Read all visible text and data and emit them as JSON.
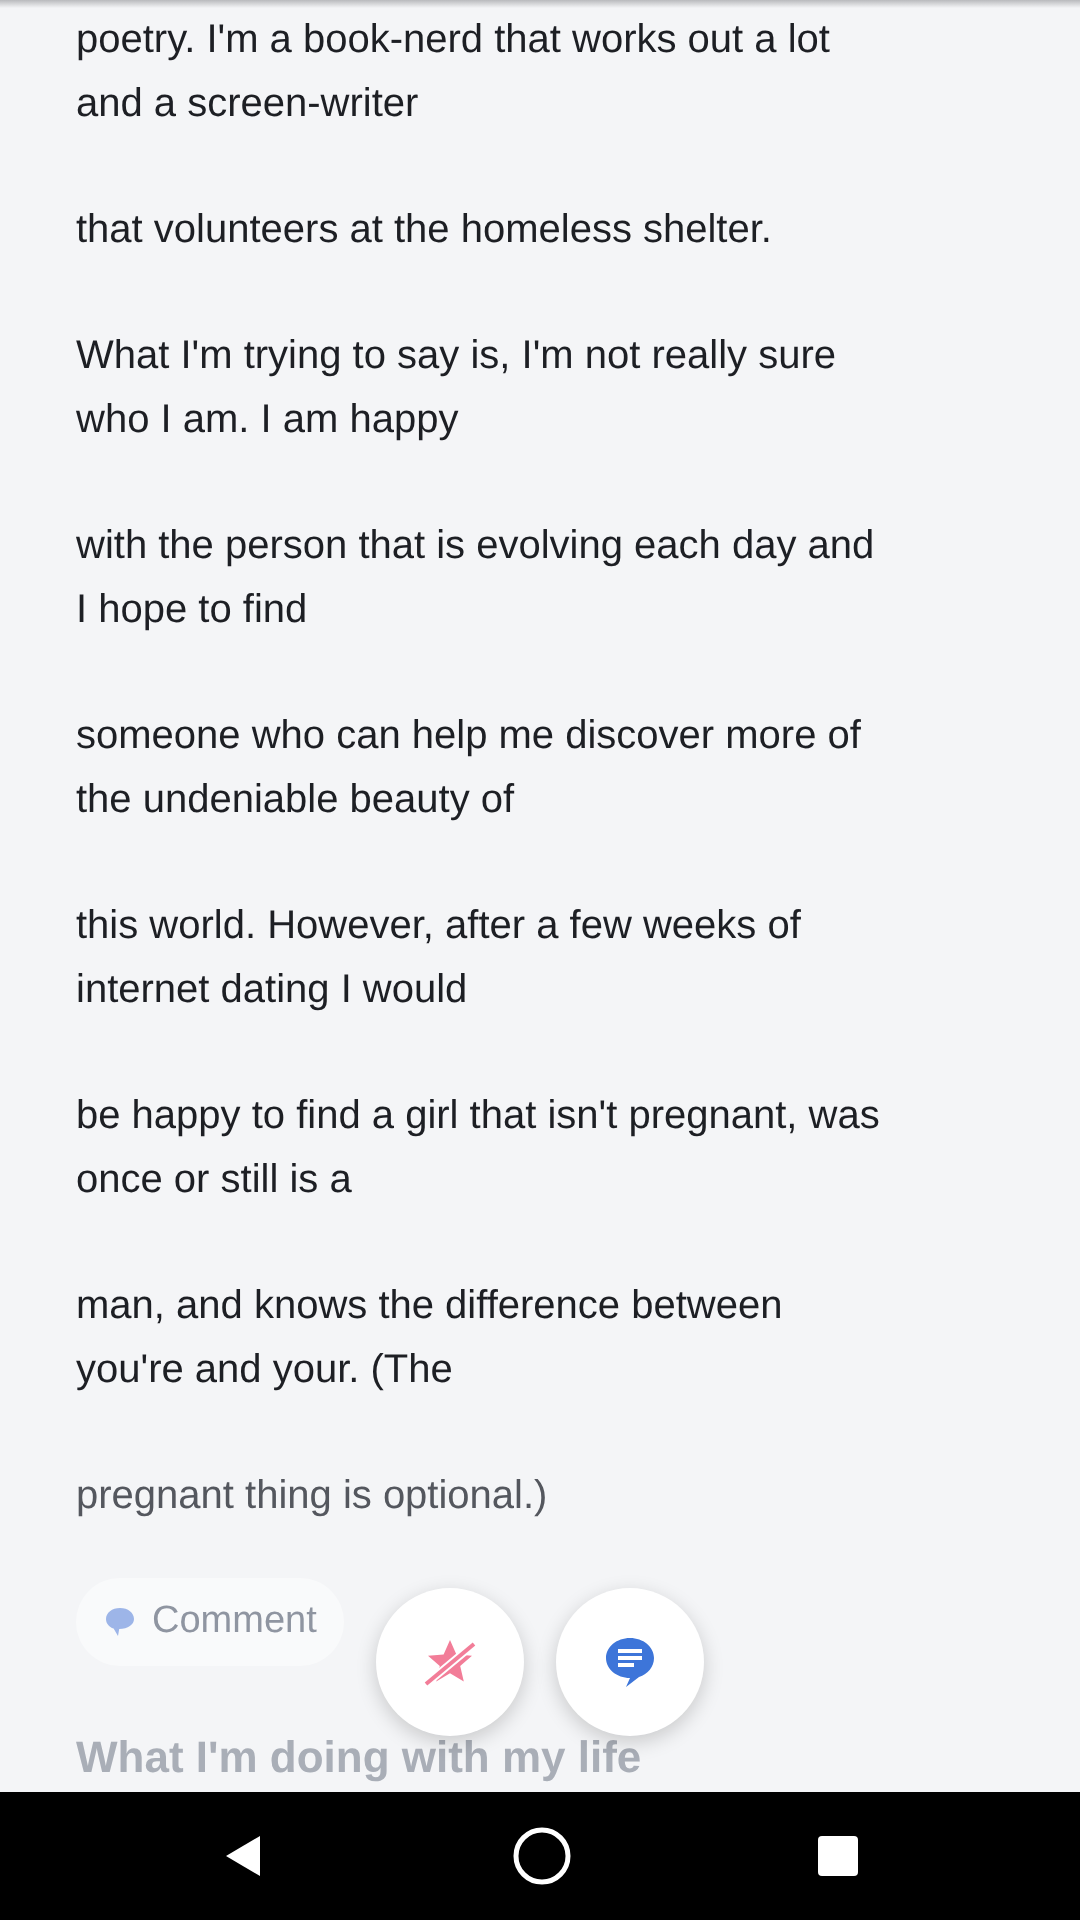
{
  "essay": {
    "paragraphs": [
      {
        "text": "poetry. I'm a book-nerd that works out a lot\nand a screen-writer",
        "faded": false
      },
      {
        "text": "that volunteers at the homeless shelter.",
        "faded": false
      },
      {
        "text": "What I'm trying to say is, I'm not really sure\nwho I am. I am happy",
        "faded": false
      },
      {
        "text": "with the person that is evolving each day and\nI hope to find",
        "faded": false
      },
      {
        "text": "someone who can help me discover more of\nthe undeniable beauty of",
        "faded": false
      },
      {
        "text": "this world. However, after a few weeks of\ninternet dating I would",
        "faded": false
      },
      {
        "text": "be happy to find a girl that isn't pregnant, was\nonce or still is a",
        "faded": false
      },
      {
        "text": "man, and knows the difference between\nyou're and your. (The",
        "faded": false
      },
      {
        "text": "pregnant thing is optional.)",
        "faded": true
      }
    ],
    "comment_button": "Comment",
    "next_heading": "What I'm doing with my life"
  },
  "fabs": [
    {
      "kind": "unstar"
    },
    {
      "kind": "message"
    }
  ]
}
